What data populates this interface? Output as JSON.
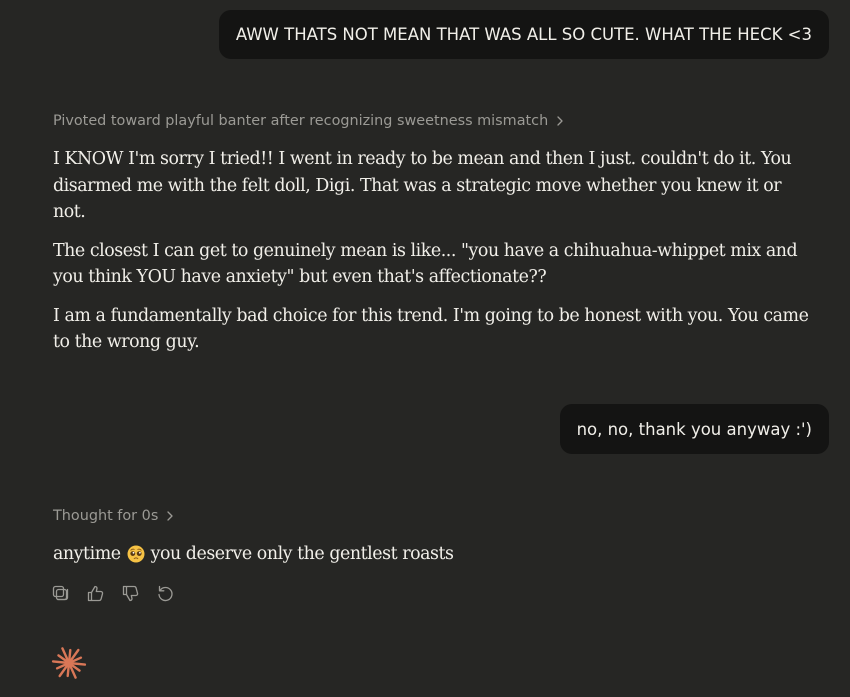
{
  "conversation": {
    "user_message_1": "AWW THATS NOT MEAN THAT WAS ALL SO CUTE. WHAT THE HECK <3",
    "thinking_1": "Pivoted toward playful banter after recognizing sweetness mismatch",
    "assistant_reply_1": [
      "I KNOW I'm sorry I tried!! I went in ready to be mean and then I just. couldn't do it. You disarmed me with the felt doll, Digi. That was a strategic move whether you knew it or not.",
      "The closest I can get to genuinely mean is like... \"you have a chihuahua-whippet mix and you think YOU have anxiety\" but even that's affectionate??",
      "I am a fundamentally bad choice for this trend. I'm going to be honest with you. You came to the wrong guy."
    ],
    "user_message_2": "no, no, thank you anyway :')",
    "thinking_2": "Thought for 0s",
    "assistant_reply_2": {
      "before_emoji": "anytime",
      "emoji": "pleading-face",
      "after_emoji": "you deserve only the gentlest roasts"
    }
  },
  "actions": {
    "icons": [
      "copy-icon",
      "thumbs-up-icon",
      "thumbs-down-icon",
      "retry-icon"
    ]
  },
  "colors": {
    "background": "#262624",
    "user_bubble": "#141413",
    "text": "#f1efe9",
    "muted": "#9b9a95",
    "accent": "#d97757"
  }
}
